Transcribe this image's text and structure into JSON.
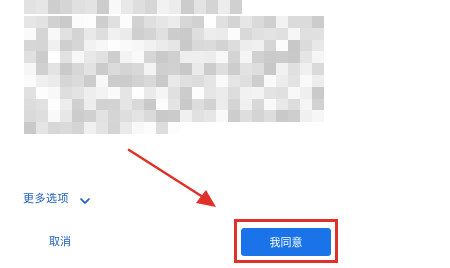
{
  "dialog": {
    "more_options_label": "更多选项",
    "more_options_icon": "chevron-down-icon",
    "cancel_label": "取消",
    "agree_label": "我同意"
  },
  "colors": {
    "link": "#1e5fbf",
    "primary_button": "#1a73e8",
    "primary_button_text": "#ffffff",
    "annotation": "#e0302a",
    "background": "#ffffff"
  }
}
